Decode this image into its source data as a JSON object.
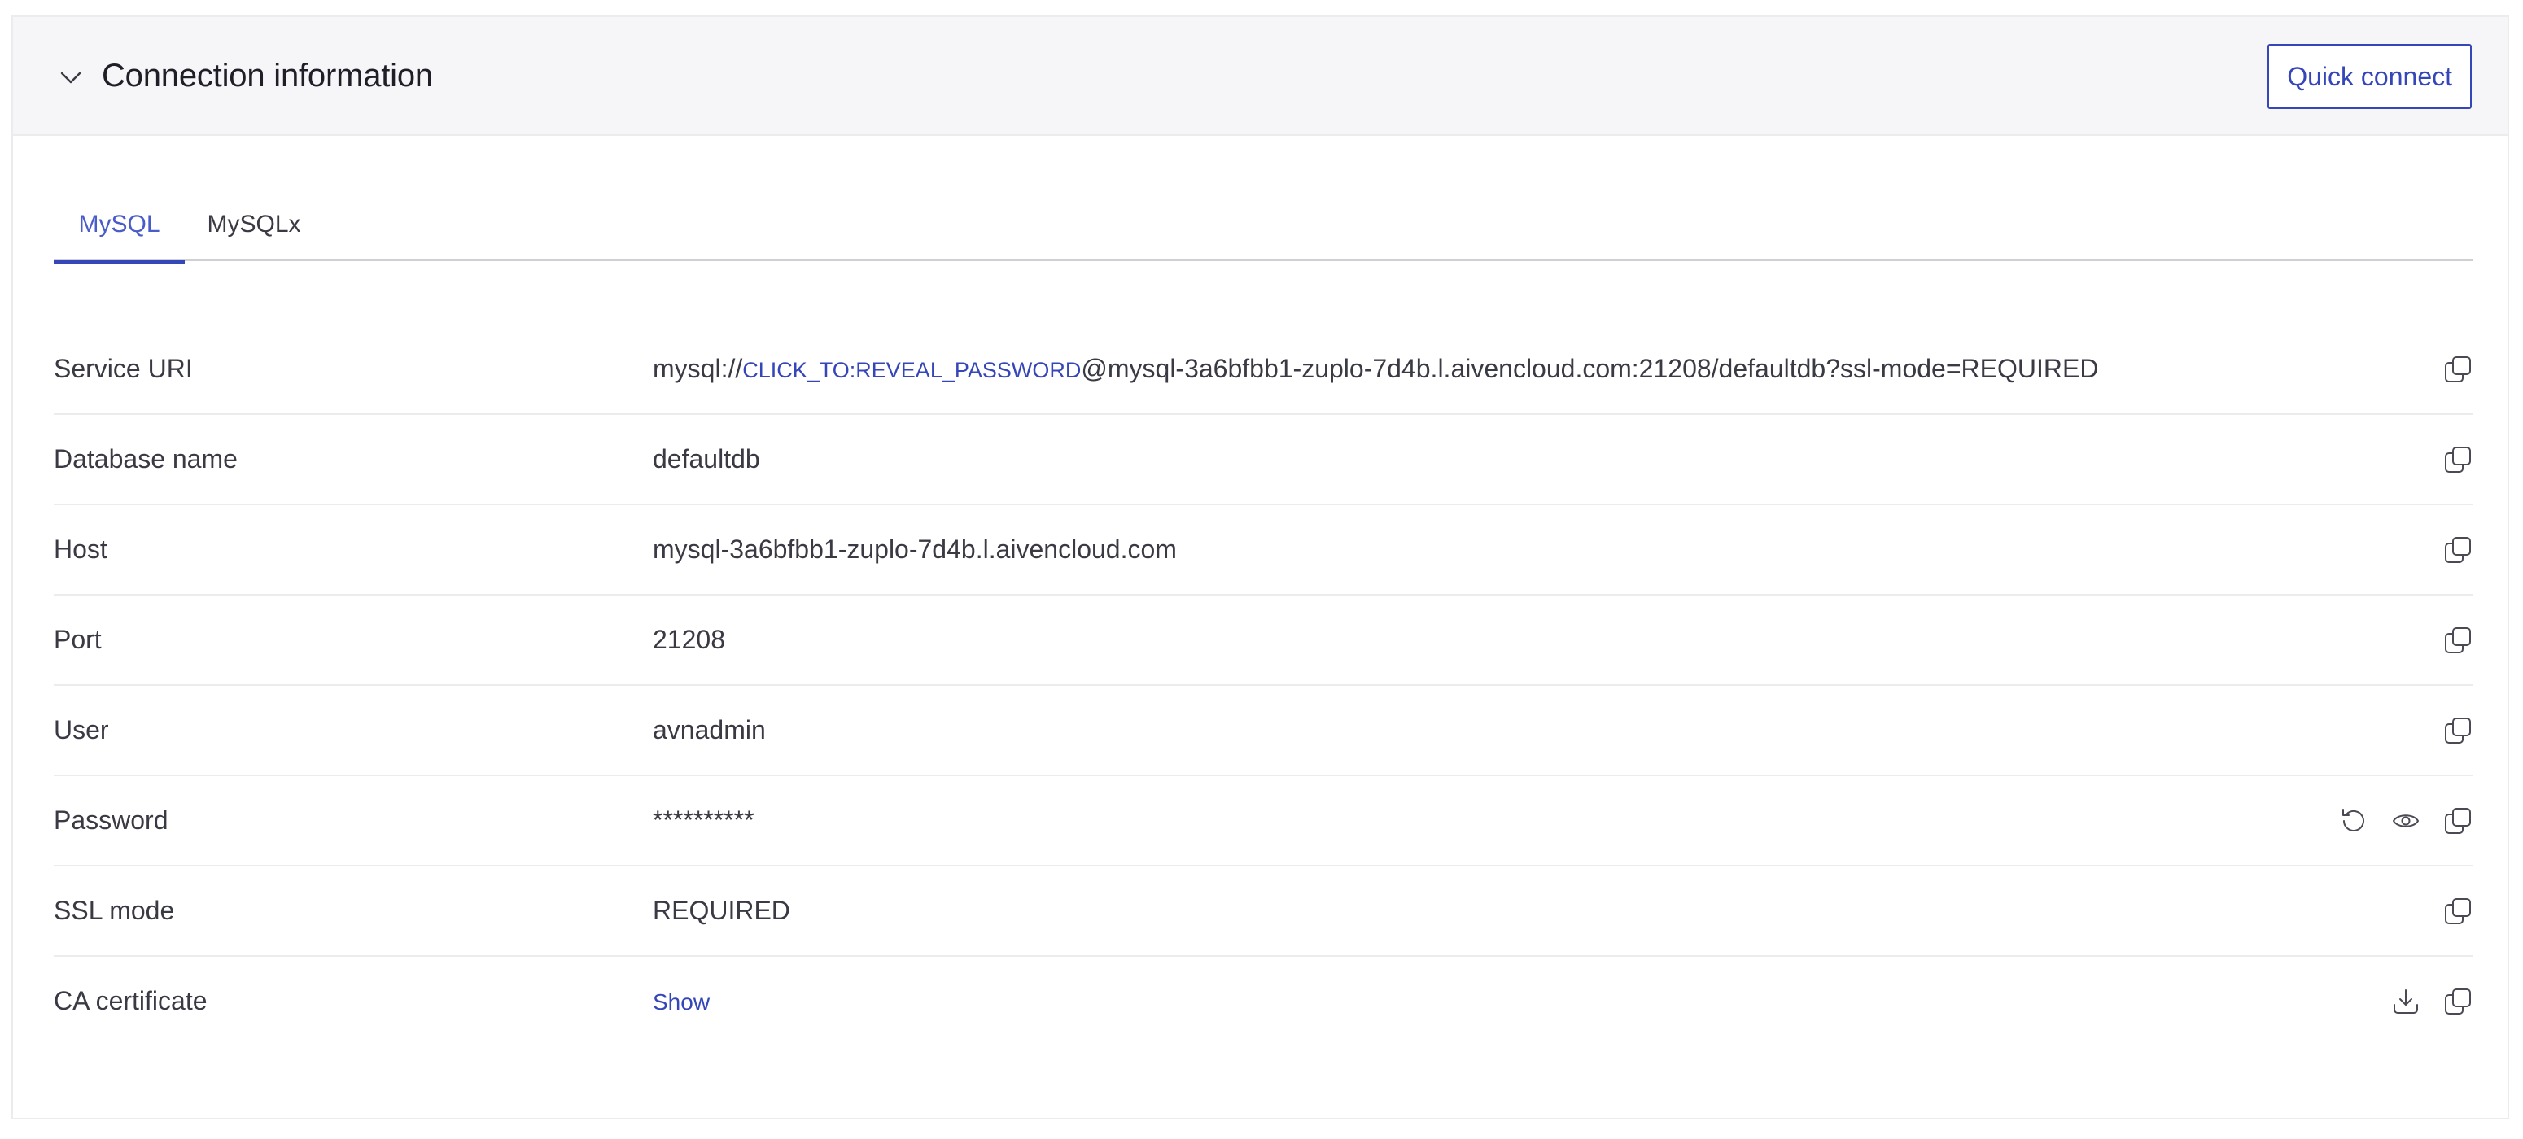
{
  "panel": {
    "title": "Connection information",
    "collapse_icon": "chevron-down-icon",
    "quick_connect_label": "Quick connect"
  },
  "tabs": [
    {
      "label": "MySQL",
      "active": true
    },
    {
      "label": "MySQLx",
      "active": false
    }
  ],
  "rows": [
    {
      "label": "Service URI",
      "value_prefix": "mysql://",
      "value_secret": "CLICK_TO:REVEAL_PASSWORD",
      "value_suffix": "@mysql-3a6bfbb1-zuplo-7d4b.l.aivencloud.com:21208/defaultdb?ssl-mode=REQUIRED",
      "actions": [
        "copy-icon"
      ]
    },
    {
      "label": "Database name",
      "value": "defaultdb",
      "actions": [
        "copy-icon"
      ]
    },
    {
      "label": "Host",
      "value": "mysql-3a6bfbb1-zuplo-7d4b.l.aivencloud.com",
      "actions": [
        "copy-icon"
      ]
    },
    {
      "label": "Port",
      "value": "21208",
      "actions": [
        "copy-icon"
      ]
    },
    {
      "label": "User",
      "value": "avnadmin",
      "actions": [
        "copy-icon"
      ]
    },
    {
      "label": "Password",
      "value": "**********",
      "actions": [
        "reset-icon",
        "eye-icon",
        "copy-icon"
      ]
    },
    {
      "label": "SSL mode",
      "value": "REQUIRED",
      "actions": [
        "copy-icon"
      ]
    },
    {
      "label": "CA certificate",
      "value_link": "Show",
      "actions": [
        "download-icon",
        "copy-icon"
      ]
    }
  ],
  "colors": {
    "accent": "#3546b8",
    "active_tab_text": "#4a5cc8",
    "header_bg": "#f6f6f8",
    "text": "#3a3a44",
    "title": "#1f1f28",
    "divider": "#ececee"
  }
}
